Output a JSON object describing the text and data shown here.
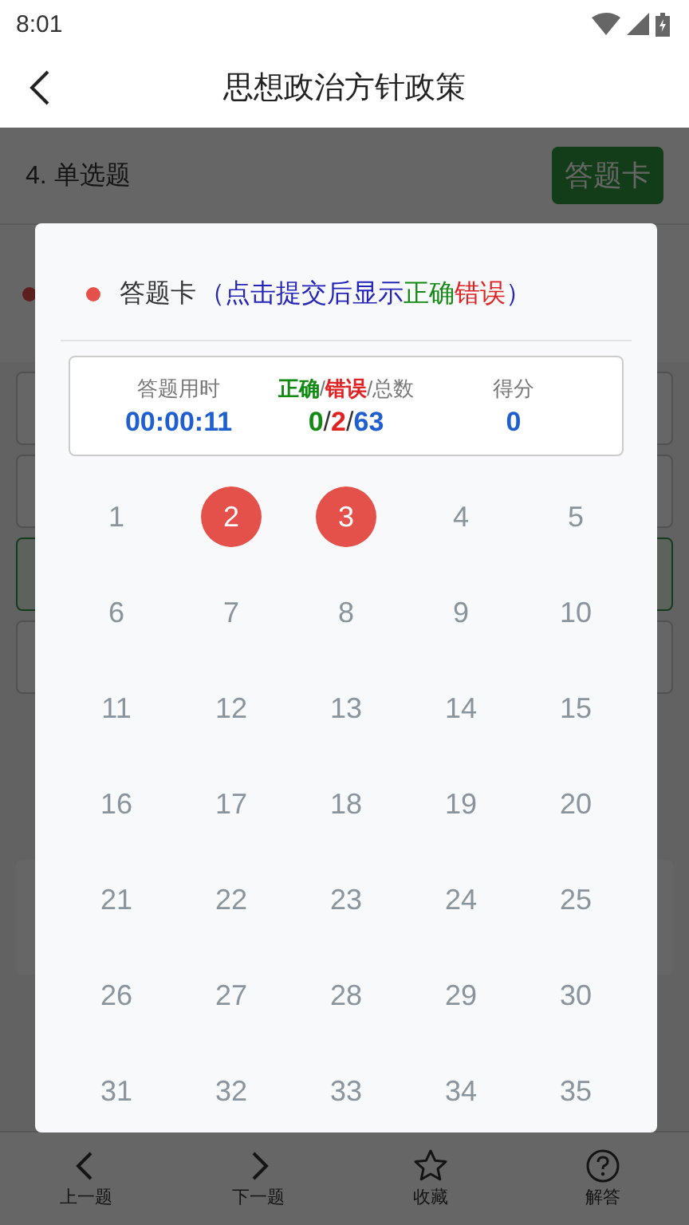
{
  "status_bar": {
    "time": "8:01"
  },
  "header": {
    "title": "思想政治方针政策"
  },
  "question": {
    "label": "4. 单选题",
    "card_button": "答题卡"
  },
  "modal": {
    "title": "答题卡",
    "hint_parts": [
      {
        "text": "（点击提交后显示",
        "kind": "note"
      },
      {
        "text": "正确",
        "kind": "correct"
      },
      {
        "text": "错误",
        "kind": "wrong"
      },
      {
        "text": "）",
        "kind": "note"
      }
    ],
    "stats": [
      {
        "label_parts": [
          {
            "text": "答题用时",
            "kind": "plain"
          }
        ],
        "value_parts": [
          {
            "text": "00:00:11",
            "kind": "total"
          }
        ]
      },
      {
        "label_parts": [
          {
            "text": "正确",
            "kind": "correct"
          },
          {
            "text": "/",
            "kind": "plain"
          },
          {
            "text": "错误",
            "kind": "wrong"
          },
          {
            "text": "/总数",
            "kind": "plain"
          }
        ],
        "value_parts": [
          {
            "text": "0",
            "kind": "correct"
          },
          {
            "text": "/",
            "kind": "sep"
          },
          {
            "text": "2",
            "kind": "wrong"
          },
          {
            "text": "/",
            "kind": "sep"
          },
          {
            "text": "63",
            "kind": "total"
          }
        ]
      },
      {
        "label_parts": [
          {
            "text": "得分",
            "kind": "plain"
          }
        ],
        "value_parts": [
          {
            "text": "0",
            "kind": "total"
          }
        ]
      }
    ],
    "numbers": [
      {
        "number": "1",
        "answered": false
      },
      {
        "number": "2",
        "answered": true
      },
      {
        "number": "3",
        "answered": true
      },
      {
        "number": "4",
        "answered": false
      },
      {
        "number": "5",
        "answered": false
      },
      {
        "number": "6",
        "answered": false
      },
      {
        "number": "7",
        "answered": false
      },
      {
        "number": "8",
        "answered": false
      },
      {
        "number": "9",
        "answered": false
      },
      {
        "number": "10",
        "answered": false
      },
      {
        "number": "11",
        "answered": false
      },
      {
        "number": "12",
        "answered": false
      },
      {
        "number": "13",
        "answered": false
      },
      {
        "number": "14",
        "answered": false
      },
      {
        "number": "15",
        "answered": false
      },
      {
        "number": "16",
        "answered": false
      },
      {
        "number": "17",
        "answered": false
      },
      {
        "number": "18",
        "answered": false
      },
      {
        "number": "19",
        "answered": false
      },
      {
        "number": "20",
        "answered": false
      },
      {
        "number": "21",
        "answered": false
      },
      {
        "number": "22",
        "answered": false
      },
      {
        "number": "23",
        "answered": false
      },
      {
        "number": "24",
        "answered": false
      },
      {
        "number": "25",
        "answered": false
      },
      {
        "number": "26",
        "answered": false
      },
      {
        "number": "27",
        "answered": false
      },
      {
        "number": "28",
        "answered": false
      },
      {
        "number": "29",
        "answered": false
      },
      {
        "number": "30",
        "answered": false
      },
      {
        "number": "31",
        "answered": false
      },
      {
        "number": "32",
        "answered": false
      },
      {
        "number": "33",
        "answered": false
      },
      {
        "number": "34",
        "answered": false
      },
      {
        "number": "35",
        "answered": false
      }
    ]
  },
  "bottom_nav": [
    {
      "label": "上一题",
      "kind": "prev"
    },
    {
      "label": "下一题",
      "kind": "next"
    },
    {
      "label": "收藏",
      "kind": "star"
    },
    {
      "label": "解答",
      "kind": "help"
    }
  ]
}
